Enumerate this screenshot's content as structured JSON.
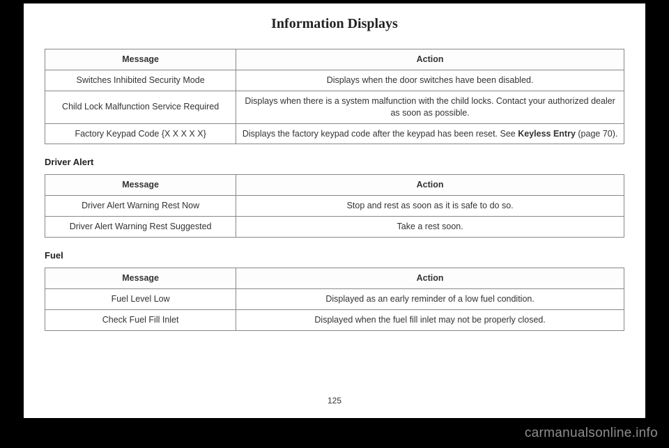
{
  "page_title": "Information Displays",
  "page_number": "125",
  "watermark": "carmanualsonline.info",
  "headers": {
    "message": "Message",
    "action": "Action"
  },
  "table1": {
    "rows": [
      {
        "msg": "Switches Inhibited Security Mode",
        "act": "Displays when the door switches have been disabled."
      },
      {
        "msg": "Child Lock Malfunction Service Required",
        "act": "Displays when there is a system malfunction with the child locks. Contact your authorized dealer as soon as possible."
      },
      {
        "msg": "Factory Keypad Code {X X X X X}",
        "act_pre": "Displays the factory keypad code after the keypad has been reset.  See ",
        "act_bold": "Keyless Entry",
        "act_post": " (page 70)."
      }
    ]
  },
  "section2": {
    "title": "Driver Alert",
    "rows": [
      {
        "msg": "Driver Alert Warning Rest Now",
        "act": "Stop and rest as soon as it is safe to do so."
      },
      {
        "msg": "Driver Alert Warning Rest Suggested",
        "act": "Take a rest soon."
      }
    ]
  },
  "section3": {
    "title": "Fuel",
    "rows": [
      {
        "msg": "Fuel Level Low",
        "act": "Displayed as an early reminder of a low fuel condition."
      },
      {
        "msg": "Check Fuel Fill Inlet",
        "act": "Displayed when the fuel fill inlet may not be properly closed."
      }
    ]
  }
}
